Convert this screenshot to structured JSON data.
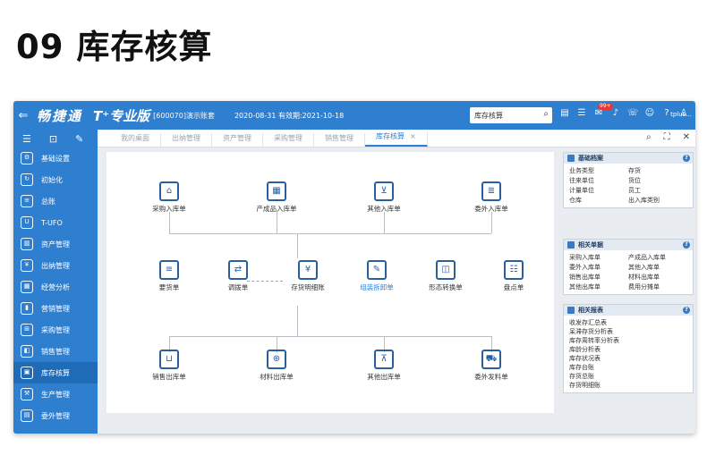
{
  "heading": "09 库存核算",
  "topbar": {
    "back": "⇐",
    "brand": "畅捷通",
    "product": "T⁺专业版",
    "account": "[600070]演示账套",
    "dates": "2020-08-31  有效期:2021-10-18",
    "search_value": "库存核算",
    "badge": "99+",
    "user": "tplus..."
  },
  "sidebar": {
    "items": [
      {
        "label": "基础设置",
        "icon": "gear-icon"
      },
      {
        "label": "初始化",
        "icon": "refresh-icon"
      },
      {
        "label": "总账",
        "icon": "ledger-icon"
      },
      {
        "label": "T-UFO",
        "icon": "ufo-icon"
      },
      {
        "label": "资产管理",
        "icon": "asset-icon"
      },
      {
        "label": "出纳管理",
        "icon": "cashier-icon"
      },
      {
        "label": "经营分析",
        "icon": "analysis-icon"
      },
      {
        "label": "营销管理",
        "icon": "marketing-icon"
      },
      {
        "label": "采购管理",
        "icon": "cart-icon"
      },
      {
        "label": "销售管理",
        "icon": "sales-icon"
      },
      {
        "label": "库存核算",
        "icon": "inventory-icon"
      },
      {
        "label": "生产管理",
        "icon": "production-icon"
      },
      {
        "label": "委外管理",
        "icon": "outsource-icon"
      }
    ]
  },
  "tabs": [
    {
      "label": "我的桌面"
    },
    {
      "label": "出纳管理"
    },
    {
      "label": "资产管理"
    },
    {
      "label": "采购管理"
    },
    {
      "label": "销售管理"
    },
    {
      "label": "库存核算",
      "close": "×"
    }
  ],
  "flow": {
    "row1": [
      "采购入库单",
      "产成品入库单",
      "其他入库单",
      "委外入库单"
    ],
    "row2": [
      "要货单",
      "调拨单",
      "存货明细账",
      "组装拆卸单",
      "形态转换单",
      "盘点单"
    ],
    "row3": [
      "销售出库单",
      "材料出库单",
      "其他出库单",
      "委外发料单"
    ]
  },
  "panels": {
    "basic": {
      "title": "基础档案",
      "items": [
        "业务类型",
        "存货",
        "往来单位",
        "货位",
        "计量单位",
        "员工",
        "仓库",
        "出入库类别"
      ]
    },
    "docs": {
      "title": "相关单据",
      "items": [
        "采购入库单",
        "产成品入库单",
        "委外入库单",
        "其他入库单",
        "销售出库单",
        "材料出库单",
        "其他出库单",
        "费用分摊单"
      ]
    },
    "reports": {
      "title": "相关报表",
      "items": [
        "收发存汇总表",
        "呆滞存货分析表",
        "库存周转率分析表",
        "库龄分析表",
        "库存状况表",
        "库存台账",
        "存货总账",
        "存货明细账"
      ]
    }
  }
}
